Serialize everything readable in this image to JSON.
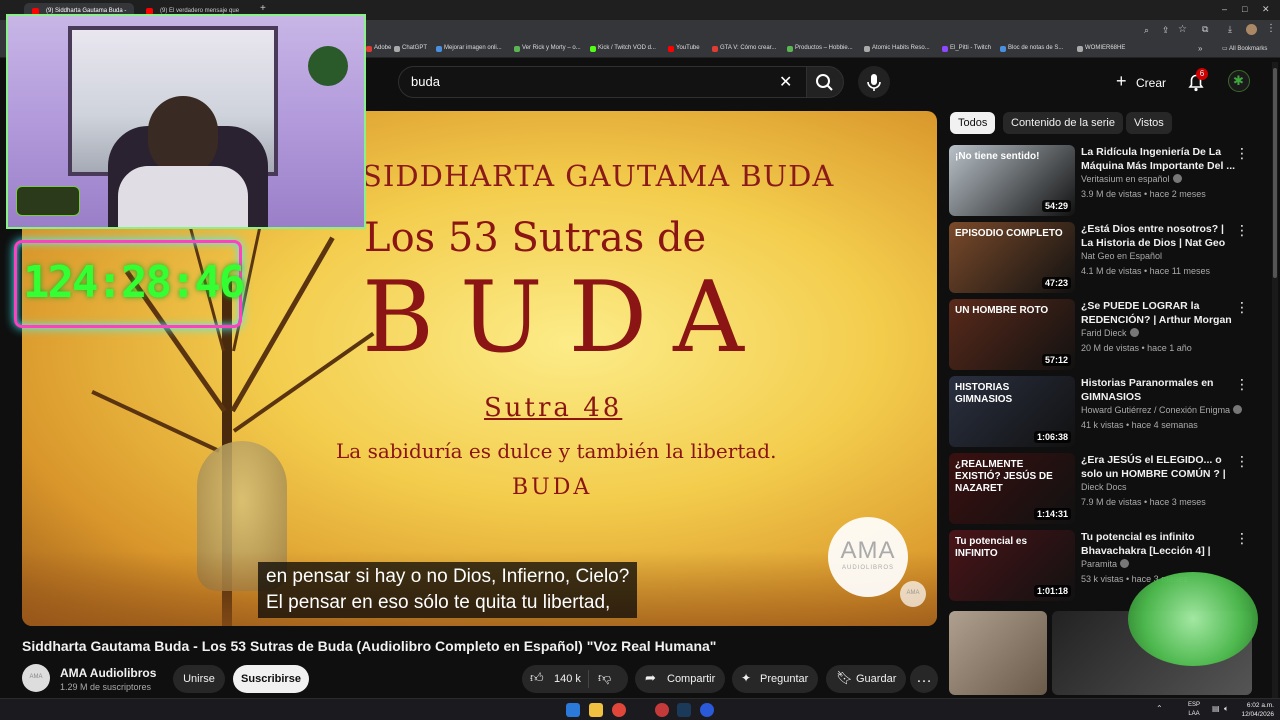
{
  "browser": {
    "tabs": [
      {
        "label": "(9) Siddharta Gautama Buda -"
      },
      {
        "label": "(9) El verdadero mensaje que"
      }
    ],
    "bookmarks": [
      {
        "label": "Adobe",
        "color": "#e03c31"
      },
      {
        "label": "ChatGPT",
        "color": "#aaaaaa"
      },
      {
        "label": "Mejorar imagen onli...",
        "color": "#4a90e2"
      },
      {
        "label": "Ver Rick y Morty – o...",
        "color": "#5ab552"
      },
      {
        "label": "Kick / Twitch VOD d...",
        "color": "#53fc18"
      },
      {
        "label": "YouTube",
        "color": "#ff0000"
      },
      {
        "label": "GTA V: Cómo crear...",
        "color": "#e03c31"
      },
      {
        "label": "Productos – Hobbie...",
        "color": "#5ab552"
      },
      {
        "label": "Atomic Habits Reso...",
        "color": "#aaaaaa"
      },
      {
        "label": "El_Pitti - Twitch",
        "color": "#9146ff"
      },
      {
        "label": "Bloc de notas de S...",
        "color": "#4a90e2"
      },
      {
        "label": "WOMIER68HE",
        "color": "#aaaaaa"
      }
    ],
    "all_bookmarks": "All Bookmarks"
  },
  "header": {
    "search_value": "buda",
    "create_label": "Crear",
    "notifications_count": "6"
  },
  "stream_overlay": {
    "timer": "124:28:46"
  },
  "video": {
    "frame": {
      "top_text": "SIDDHARTA GAUTAMA BUDA",
      "line1": "Los 53 Sutras de",
      "big": "BUDA",
      "sutra": "Sutra 48",
      "quote": "La sabiduría es dulce y también la libertad.",
      "author": "BUDA",
      "logo_main": "AMA",
      "logo_sub": "AUDIOLIBROS"
    },
    "subtitles": [
      "en pensar si hay o no Dios, Infierno, Cielo?",
      "El pensar en eso sólo te quita tu libertad,"
    ],
    "title": "Siddharta Gautama Buda - Los 53 Sutras de Buda (Audiolibro Completo en Español) \"Voz Real Humana\"",
    "channel_name": "AMA Audiolibros",
    "subscribers": "1.29 M de suscriptores",
    "avatar_text": "AMA",
    "join_label": "Unirse",
    "subscribe_label": "Suscribirse",
    "likes": "140 k",
    "share_label": "Compartir",
    "ask_label": "Preguntar",
    "save_label": "Guardar"
  },
  "sidebar": {
    "chips": [
      {
        "label": "Todos"
      },
      {
        "label": "Contenido de la serie"
      },
      {
        "label": "Vistos"
      }
    ],
    "videos": [
      {
        "title": "La Ridícula Ingeniería De La Máquina Más Importante Del ...",
        "channel": "Veritasium en español",
        "verified": true,
        "meta": "3.9 M de vistas • hace 2 meses",
        "duration": "54:29",
        "thumb_text": "¡No tiene sentido!",
        "thumb_color": "#b9c2c9"
      },
      {
        "title": "¿Está Dios entre nosotros? | La Historia de Dios | Nat Geo en ...",
        "channel": "Nat Geo en Español",
        "verified": false,
        "meta": "4.1 M de vistas • hace 11 meses",
        "duration": "47:23",
        "thumb_text": "EPISODIO COMPLETO",
        "thumb_color": "#7a4a2a"
      },
      {
        "title": "¿Se PUEDE LOGRAR la REDENCIÓN? | Arthur Morgan ...",
        "channel": "Farid Dieck",
        "verified": true,
        "meta": "20 M de vistas • hace 1 año",
        "duration": "57:12",
        "thumb_text": "UN HOMBRE ROTO",
        "thumb_color": "#5a2a1a"
      },
      {
        "title": "Historias Paranormales en GIMNASIOS",
        "channel": "Howard Gutiérrez / Conexión Enigma",
        "verified": true,
        "meta": "41 k vistas • hace 4 semanas",
        "duration": "1:06:38",
        "thumb_text": "HISTORIAS GIMNASIOS",
        "thumb_color": "#2a3040"
      },
      {
        "title": "¿Era JESÚS el ELEGIDO... o solo un HOMBRE COMÚN ? | Jesús ...",
        "channel": "Dieck Docs",
        "verified": false,
        "meta": "7.9 M de vistas • hace 3 meses",
        "duration": "1:14:31",
        "thumb_text": "¿REALMENTE EXISTIÓ? JESÚS DE NAZARET",
        "thumb_color": "#3a1010"
      },
      {
        "title": "Tu potencial es infinito Bhavachakra [Lección 4] | Lam...",
        "channel": "Paramita",
        "verified": true,
        "meta": "53 k vistas • hace 3 meses",
        "duration": "1:01:18",
        "thumb_text": "Tu potencial es INFINITO",
        "thumb_color": "#4a1418"
      }
    ]
  },
  "taskbar": {
    "lang_line1": "ESP",
    "lang_line2": "LAA",
    "time": "6:02 a.m.",
    "date": "12/04/2026"
  },
  "colors": {
    "accent_red": "#ff0000",
    "bg": "#0f0f0f",
    "timer_green": "#33ff33",
    "timer_border": "#ff40c0"
  }
}
